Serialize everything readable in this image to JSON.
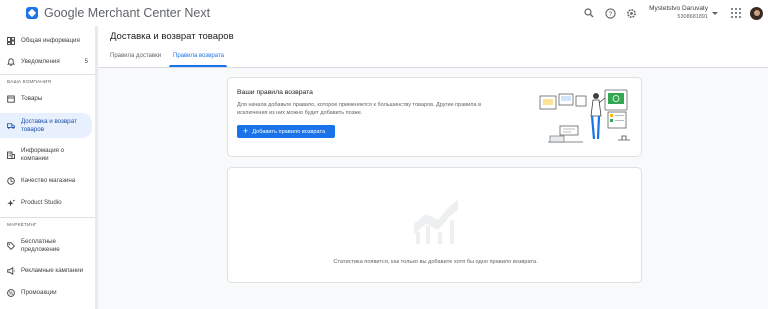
{
  "header": {
    "app_title": "Google Merchant Center Next",
    "account_name": "Mystetstvo Daruvaty",
    "account_id": "5308681891",
    "icons": [
      "search-icon",
      "help-icon",
      "settings-icon",
      "apps-icon",
      "avatar"
    ]
  },
  "sidebar": {
    "items": [
      {
        "label": "Общая информация",
        "icon": "dashboard-icon"
      },
      {
        "label": "Уведомления",
        "icon": "bell-icon",
        "badge": "5"
      },
      {
        "label": "Товары",
        "icon": "products-icon"
      },
      {
        "label": "Доставка и возврат товаров",
        "icon": "truck-icon",
        "active": true
      },
      {
        "label": "Информация о компании",
        "icon": "business-icon"
      },
      {
        "label": "Качество магазина",
        "icon": "quality-icon"
      },
      {
        "label": "Product Studio",
        "icon": "sparkle-icon"
      },
      {
        "label": "Бесплатные предложение",
        "icon": "tag-icon"
      },
      {
        "label": "Рекламные кампании",
        "icon": "campaign-icon"
      },
      {
        "label": "Промоакции",
        "icon": "promo-icon"
      }
    ],
    "sections": {
      "company": "ВАША КОМПАНИЯ",
      "marketing": "МАРКЕТИНГ"
    }
  },
  "main": {
    "page_title": "Доставка и возврат товаров",
    "tabs": [
      {
        "label": "Правила доставки",
        "active": false
      },
      {
        "label": "Правила возврата",
        "active": true
      }
    ],
    "return_card": {
      "title": "Ваши правила возврата",
      "description": "Для начала добавьте правило, которое применяется к большинству товаров. Другие правила в исключения из них можно будет добавить позже.",
      "button_label": "Добавить правило возврата"
    },
    "stats_card": {
      "empty_text": "Статистика появится, как только вы добавите хотя бы одно правило возврата."
    }
  },
  "colors": {
    "accent": "#1a73e8",
    "active_nav_bg": "#e8f0fe",
    "page_bg": "#f8f9fa"
  }
}
